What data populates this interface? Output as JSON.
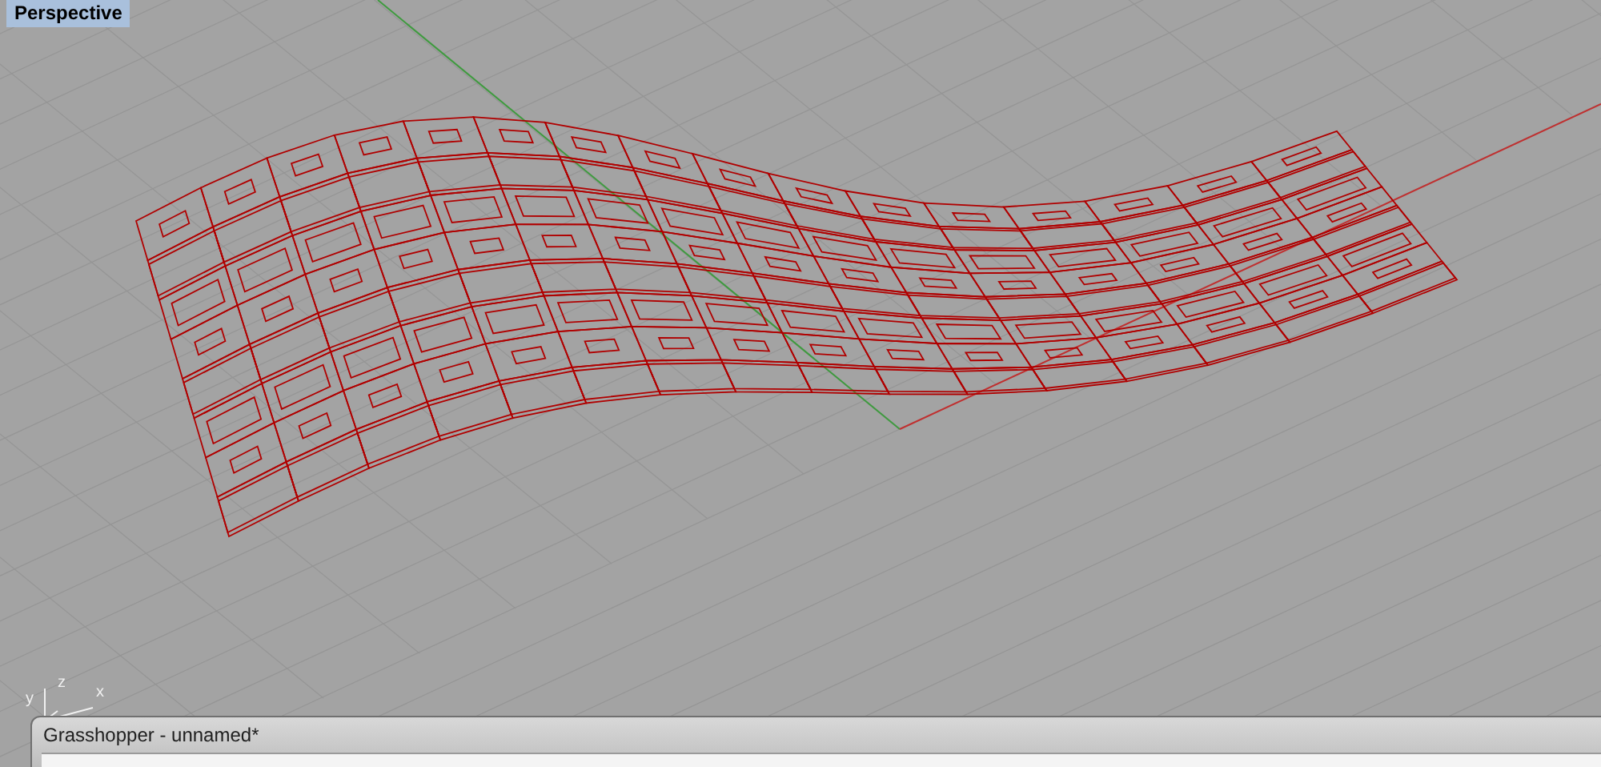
{
  "viewport": {
    "label": "Perspective"
  },
  "axis_triad": {
    "labels": [
      "y",
      "z",
      "x"
    ]
  },
  "grasshopper_window": {
    "title": "Grasshopper - unnamed*"
  }
}
